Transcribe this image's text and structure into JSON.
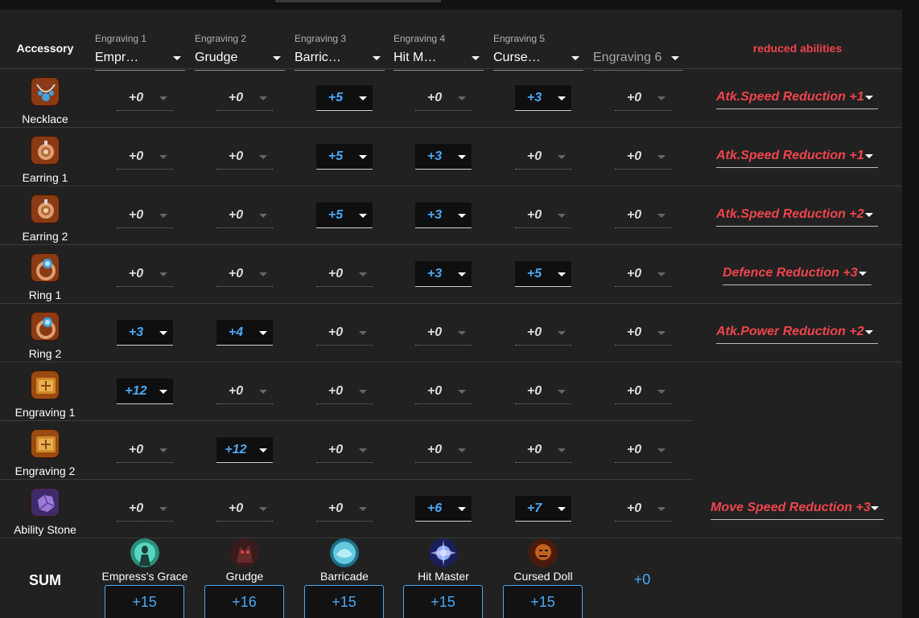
{
  "header": {
    "accessory_label": "Accessory",
    "reduced_label": "reduced abilities",
    "engravings": [
      {
        "label": "Engraving 1",
        "value": "Empress's Grace",
        "display": "Empr…"
      },
      {
        "label": "Engraving 2",
        "value": "Grudge",
        "display": "Grudge"
      },
      {
        "label": "Engraving 3",
        "value": "Barricade",
        "display": "Barric…"
      },
      {
        "label": "Engraving 4",
        "value": "Hit Master",
        "display": "Hit M…"
      },
      {
        "label": "Engraving 5",
        "value": "Cursed Doll",
        "display": "Curse…"
      },
      {
        "label": "",
        "value": "",
        "display": "Engraving 6"
      }
    ]
  },
  "rows": [
    {
      "name": "Necklace",
      "icon": "necklace-icon",
      "values": [
        "+0",
        "+0",
        "+5",
        "+0",
        "+3",
        "+0"
      ],
      "reduced": "Atk.Speed Reduction +1"
    },
    {
      "name": "Earring 1",
      "icon": "earring-icon",
      "values": [
        "+0",
        "+0",
        "+5",
        "+3",
        "+0",
        "+0"
      ],
      "reduced": "Atk.Speed Reduction +1"
    },
    {
      "name": "Earring 2",
      "icon": "earring-icon",
      "values": [
        "+0",
        "+0",
        "+5",
        "+3",
        "+0",
        "+0"
      ],
      "reduced": "Atk.Speed Reduction +2"
    },
    {
      "name": "Ring 1",
      "icon": "ring-icon",
      "values": [
        "+0",
        "+0",
        "+0",
        "+3",
        "+5",
        "+0"
      ],
      "reduced": "Defence Reduction +3"
    },
    {
      "name": "Ring 2",
      "icon": "ring-icon",
      "values": [
        "+3",
        "+4",
        "+0",
        "+0",
        "+0",
        "+0"
      ],
      "reduced": "Atk.Power Reduction +2"
    },
    {
      "name": "Engraving 1",
      "icon": "engraving-book-icon",
      "values": [
        "+12",
        "+0",
        "+0",
        "+0",
        "+0",
        "+0"
      ],
      "reduced": ""
    },
    {
      "name": "Engraving 2",
      "icon": "engraving-book-icon",
      "values": [
        "+0",
        "+12",
        "+0",
        "+0",
        "+0",
        "+0"
      ],
      "reduced": ""
    },
    {
      "name": "Ability Stone",
      "icon": "ability-stone-icon",
      "values": [
        "+0",
        "+0",
        "+0",
        "+6",
        "+7",
        "+0"
      ],
      "reduced": "Move Speed Reduction +3"
    }
  ],
  "sum": {
    "label": "SUM",
    "columns": [
      {
        "name": "Empress's Grace",
        "icon": "empress-grace-icon",
        "total": "+15"
      },
      {
        "name": "Grudge",
        "icon": "grudge-icon",
        "total": "+16"
      },
      {
        "name": "Barricade",
        "icon": "barricade-icon",
        "total": "+15"
      },
      {
        "name": "Hit Master",
        "icon": "hit-master-icon",
        "total": "+15"
      },
      {
        "name": "Cursed Doll",
        "icon": "cursed-doll-icon",
        "total": "+15"
      }
    ],
    "extra_total": "+0"
  },
  "colors": {
    "background": "#212121",
    "accent_blue": "#4aa8f5",
    "accent_red": "#f0444d"
  }
}
